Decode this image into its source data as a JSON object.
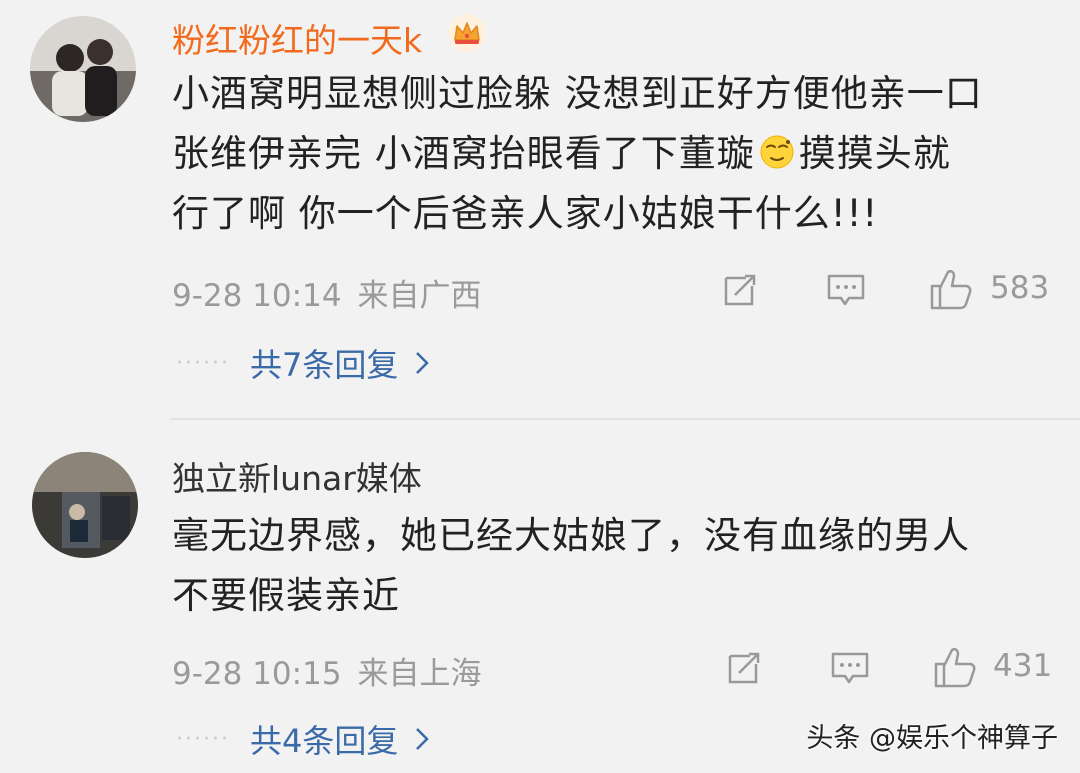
{
  "comments": [
    {
      "username": "粉红粉红的一天k",
      "badge_icon": "crown-icon",
      "lines": [
        "小酒窝明显想侧过脸躲 没想到正好方便他亲一口",
        "张维伊亲完 小酒窝抬眼看了下董璇",
        "摸摸头就",
        "行了啊 你一个后爸亲人家小姑娘干什么!!!"
      ],
      "date": "9-28 10:14",
      "location": "来自广西",
      "likes": "583",
      "replies_label": "共7条回复"
    },
    {
      "username": "独立新lunar媒体",
      "lines": [
        "毫无边界感，她已经大姑娘了，没有血缘的男人",
        "不要假装亲近"
      ],
      "date": "9-28 10:15",
      "location": "来自上海",
      "likes": "431",
      "replies_label": "共4条回复"
    }
  ],
  "replies_dots": "······",
  "watermark": "头条 @娱乐个神算子",
  "colors": {
    "background": "#f2f2f2",
    "username_vip": "#f26b1d",
    "username": "#333333",
    "link": "#3b6aa8",
    "meta": "#9a9a9a"
  }
}
